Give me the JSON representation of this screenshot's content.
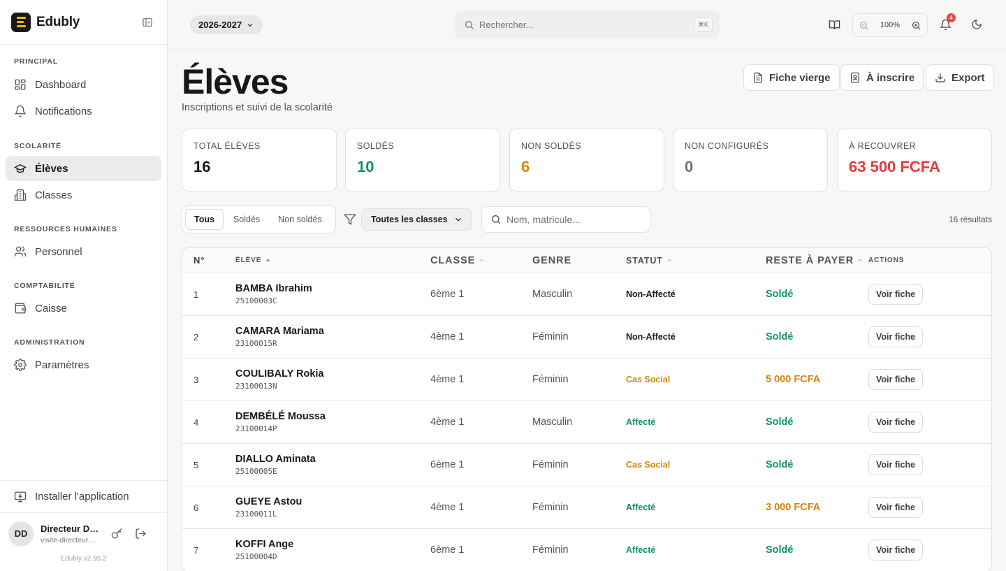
{
  "app": {
    "name": "Edubly",
    "version": "Edubly v2.95.2"
  },
  "sidebar": {
    "sections": [
      {
        "title": "PRINCIPAL",
        "items": [
          {
            "label": "Dashboard"
          },
          {
            "label": "Notifications"
          }
        ]
      },
      {
        "title": "SCOLARITÉ",
        "items": [
          {
            "label": "Élèves",
            "active": true
          },
          {
            "label": "Classes"
          }
        ]
      },
      {
        "title": "RESSOURCES HUMAINES",
        "items": [
          {
            "label": "Personnel"
          }
        ]
      },
      {
        "title": "COMPTABILITÉ",
        "items": [
          {
            "label": "Caisse"
          }
        ]
      },
      {
        "title": "ADMINISTRATION",
        "items": [
          {
            "label": "Paramètres"
          }
        ]
      }
    ],
    "install_label": "Installer l'application",
    "user": {
      "initials": "DD",
      "name": "Directeur Démo",
      "email": "visite-directeur@edubly.app"
    }
  },
  "topbar": {
    "year": "2026-2027",
    "search_placeholder": "Rechercher...",
    "search_shortcut": "⌘K",
    "zoom_level": "100%",
    "notification_count": "4"
  },
  "page": {
    "title": "Élèves",
    "subtitle": "Inscriptions et suivi de la scolarité",
    "buttons": {
      "blank_form": "Fiche vierge",
      "to_enroll": "À inscrire",
      "export": "Export"
    }
  },
  "stats": [
    {
      "label": "TOTAL ÉLÈVES",
      "value": "16",
      "color": "#18181b"
    },
    {
      "label": "SOLDÉS",
      "value": "10",
      "color": "#15935c"
    },
    {
      "label": "NON SOLDÉS",
      "value": "6",
      "color": "#d6870a"
    },
    {
      "label": "NON CONFIGURÉS",
      "value": "0",
      "color": "#71717a"
    },
    {
      "label": "À RECOUVRER",
      "value": "63 500 FCFA",
      "color": "#e23b3b"
    }
  ],
  "filters": {
    "tabs": [
      {
        "label": "Tous",
        "active": true
      },
      {
        "label": "Soldés"
      },
      {
        "label": "Non soldés"
      }
    ],
    "class_select": "Toutes les classes",
    "search_placeholder": "Nom, matricule...",
    "results": "16 résultats"
  },
  "table": {
    "headers": {
      "num": "N°",
      "student": "ÉLÈVE",
      "class": "CLASSE",
      "gender": "GENRE",
      "status": "STATUT",
      "due": "RESTE À PAYER",
      "actions": "ACTIONS"
    },
    "action_label": "Voir fiche",
    "colors": {
      "neutral": "#18181b",
      "green": "#15935c",
      "orange": "#d6870a"
    },
    "rows": [
      {
        "num": "1",
        "name": "BAMBA Ibrahim",
        "matricule": "25100003C",
        "class": "6ème 1",
        "gender": "Masculin",
        "status": "Non-Affecté",
        "status_color": "neutral",
        "due": "Soldé",
        "due_color": "green"
      },
      {
        "num": "2",
        "name": "CAMARA Mariama",
        "matricule": "23100015R",
        "class": "4ème 1",
        "gender": "Féminin",
        "status": "Non-Affecté",
        "status_color": "neutral",
        "due": "Soldé",
        "due_color": "green"
      },
      {
        "num": "3",
        "name": "COULIBALY Rokia",
        "matricule": "23100013N",
        "class": "4ème 1",
        "gender": "Féminin",
        "status": "Cas Social",
        "status_color": "orange",
        "due": "5 000 FCFA",
        "due_color": "orange"
      },
      {
        "num": "4",
        "name": "DEMBÉLÉ Moussa",
        "matricule": "23100014P",
        "class": "4ème 1",
        "gender": "Masculin",
        "status": "Affecté",
        "status_color": "green",
        "due": "Soldé",
        "due_color": "green"
      },
      {
        "num": "5",
        "name": "DIALLO Aminata",
        "matricule": "25100005E",
        "class": "6ème 1",
        "gender": "Féminin",
        "status": "Cas Social",
        "status_color": "orange",
        "due": "Soldé",
        "due_color": "green"
      },
      {
        "num": "6",
        "name": "GUEYE Astou",
        "matricule": "23100011L",
        "class": "4ème 1",
        "gender": "Féminin",
        "status": "Affecté",
        "status_color": "green",
        "due": "3 000 FCFA",
        "due_color": "orange"
      },
      {
        "num": "7",
        "name": "KOFFI Ange",
        "matricule": "25100004D",
        "class": "6ème 1",
        "gender": "Féminin",
        "status": "Affecté",
        "status_color": "green",
        "due": "Soldé",
        "due_color": "green"
      }
    ]
  }
}
